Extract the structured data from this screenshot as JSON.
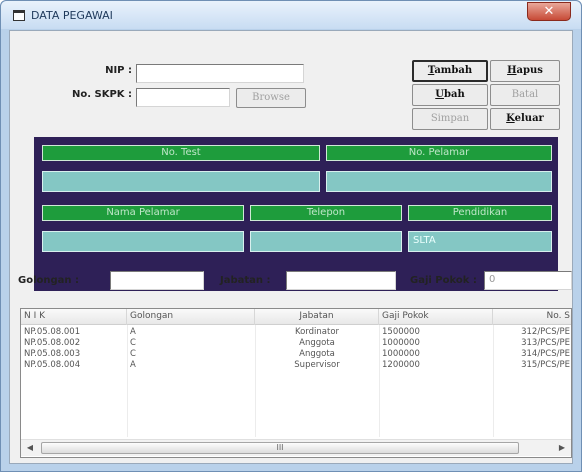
{
  "window": {
    "title": "DATA PEGAWAI",
    "close_glyph": "✕"
  },
  "form": {
    "nip_label": "NIP :",
    "nip_value": "",
    "skpk_label": "No. SKPK :",
    "skpk_value": "",
    "browse_label": "Browse"
  },
  "buttons": {
    "tambah": {
      "first": "T",
      "rest": "ambah"
    },
    "hapus": {
      "first": "H",
      "rest": "apus"
    },
    "ubah": {
      "first": "U",
      "rest": "bah"
    },
    "batal": "Batal",
    "simpan": "Simpan",
    "keluar": {
      "first": "K",
      "rest": "eluar"
    }
  },
  "grid": {
    "no_test": "No. Test",
    "no_pelamar": "No. Pelamar",
    "no_test_value": "",
    "no_pelamar_value": "",
    "nama_pelamar": "Nama Pelamar",
    "telepon": "Telepon",
    "pendidikan": "Pendidikan",
    "nama_value": "",
    "telepon_value": "",
    "pendidikan_value": "SLTA"
  },
  "fields": {
    "golongan_label": "Golongan :",
    "golongan_value": "",
    "jabatan_label": "Jabatan :",
    "jabatan_value": "",
    "gaji_label": "Gaji Pokok :",
    "gaji_value": "0"
  },
  "table": {
    "columns": [
      "N I K",
      "Golongan",
      "Jabatan",
      "Gaji Pokok",
      "No. S"
    ],
    "rows": [
      [
        "NP.05.08.001",
        "A",
        "Kordinator",
        "1500000",
        "312/PCS/PE"
      ],
      [
        "NP.05.08.002",
        "C",
        "Anggota",
        "1000000",
        "313/PCS/PE"
      ],
      [
        "NP.05.08.003",
        "C",
        "Anggota",
        "1000000",
        "314/PCS/PE"
      ],
      [
        "NP.05.08.004",
        "A",
        "Supervisor",
        "1200000",
        "315/PCS/PE"
      ]
    ]
  },
  "scrollbar": {
    "left_arrow": "◀",
    "right_arrow": "▶",
    "grip": "III"
  },
  "colors": {
    "panel": "#2e2057",
    "header_green": "#1e9c3c",
    "field_teal": "#84c7c4"
  }
}
